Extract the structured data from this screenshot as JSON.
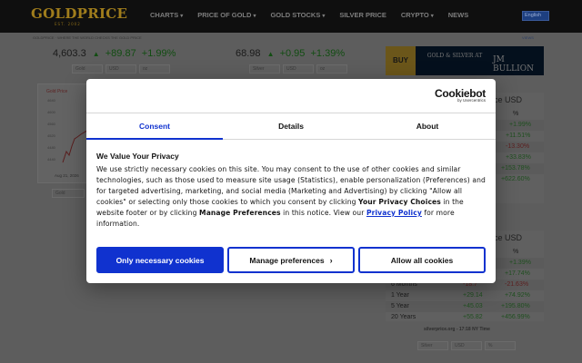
{
  "header": {
    "logo": "GOLDPRICE",
    "logo_sub": "EST. 2002",
    "nav": [
      "CHARTS",
      "PRICE OF GOLD",
      "GOLD STOCKS",
      "SILVER PRICE",
      "CRYPTO",
      "NEWS"
    ],
    "language": "English"
  },
  "subheader": {
    "tagline": "GOLDPRICE · WHERE THE WORLD CHECKS THE GOLD PRICE",
    "right": "VIEWS"
  },
  "tickers": {
    "gold": {
      "price": "4,603.3",
      "change": "+89.87",
      "percent": "+1.99%",
      "selects": [
        "Gold",
        "USD",
        "oz"
      ]
    },
    "silver": {
      "price": "68.98",
      "change": "+0.95",
      "percent": "+1.39%",
      "selects": [
        "Silver",
        "USD",
        "oz"
      ]
    }
  },
  "ad": {
    "buy": "BUY",
    "line": "GOLD & SILVER AT",
    "brand": "JM BULLION"
  },
  "mini_chart": {
    "title": "Gold Price",
    "ticks": [
      "4640",
      "4600",
      "4560",
      "4520",
      "4480",
      "4440"
    ],
    "date": "Aug 21, 2026",
    "select": "Gold"
  },
  "gold_table": {
    "title": "Gold Price USD",
    "header": "%",
    "rows": [
      {
        "label": "",
        "value": "",
        "pct": "+1.99%"
      },
      {
        "label": "",
        "value": "",
        "pct": "+11.51%"
      },
      {
        "label": "",
        "value": "",
        "pct": "-13.30%"
      },
      {
        "label": "",
        "value": "",
        "pct": "+33.83%"
      },
      {
        "label": "",
        "value": "",
        "pct": "+153.78%"
      },
      {
        "label": "",
        "value": "",
        "pct": "+622.60%"
      }
    ]
  },
  "silver_table": {
    "title": "Silver Price USD",
    "header": "%",
    "rows": [
      {
        "label": "",
        "value": "",
        "pct": "+1.39%"
      },
      {
        "label": "",
        "value": "",
        "pct": "+17.74%"
      },
      {
        "label": "6 Months",
        "value": "-18.7",
        "pct": "-21.63%"
      },
      {
        "label": "1 Year",
        "value": "+29.14",
        "pct": "+74.92%"
      },
      {
        "label": "5 Year",
        "value": "+45.03",
        "pct": "+195.80%"
      },
      {
        "label": "20 Years",
        "value": "+55.82",
        "pct": "+456.99%"
      }
    ],
    "footer": "silverprice.org - 17:18 NY Time",
    "selects": [
      "Silver",
      "USD",
      "%"
    ]
  },
  "cookie": {
    "brand": "Cookiebot",
    "brand_sub": "by Usercentrics",
    "tabs": [
      "Consent",
      "Details",
      "About"
    ],
    "title": "We Value Your Privacy",
    "text_1": "We use strictly necessary cookies on this site.  You may consent to the use of other cookies and similar technologies, such as those used to measure site usage (Statistics), enable personalization (Preferences) and for targeted advertising, marketing, and social media (Marketing and Advertising) by clicking \"Allow all cookies\" or selecting only those cookies to which you consent by clicking ",
    "bold_1": "Your Privacy Choices",
    "text_2": " in the website footer or by clicking ",
    "bold_2": "Manage Preferences",
    "text_3": " in this notice. View our ",
    "link": "Privacy Policy",
    "text_4": " for more information.",
    "buttons": {
      "necessary": "Only necessary cookies",
      "manage": "Manage preferences",
      "allow": "Allow all cookies"
    },
    "accent": "#1032cf"
  }
}
